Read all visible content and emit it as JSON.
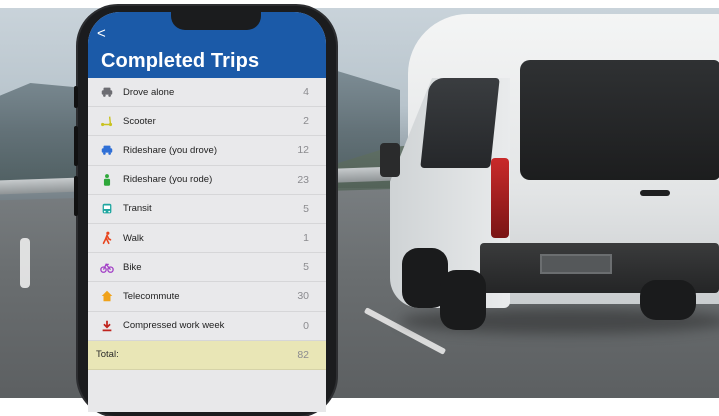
{
  "screen": {
    "back_label": "<",
    "title": "Completed Trips"
  },
  "trips": [
    {
      "label": "Drove alone",
      "value": "4",
      "icon": "car-icon",
      "color": "#6d6d72"
    },
    {
      "label": "Scooter",
      "value": "2",
      "icon": "scooter-icon",
      "color": "#c9c21f"
    },
    {
      "label": "Rideshare (you drove)",
      "value": "12",
      "icon": "car-icon",
      "color": "#2f6fd6"
    },
    {
      "label": "Rideshare (you rode)",
      "value": "23",
      "icon": "person-icon",
      "color": "#2fa83a"
    },
    {
      "label": "Transit",
      "value": "5",
      "icon": "bus-icon",
      "color": "#1fa6a0"
    },
    {
      "label": "Walk",
      "value": "1",
      "icon": "walk-icon",
      "color": "#e8451e"
    },
    {
      "label": "Bike",
      "value": "5",
      "icon": "bike-icon",
      "color": "#a23fc6"
    },
    {
      "label": "Telecommute",
      "value": "30",
      "icon": "home-icon",
      "color": "#f0a21a"
    },
    {
      "label": "Compressed work week",
      "value": "0",
      "icon": "download-icon",
      "color": "#c0231d"
    }
  ],
  "total": {
    "label": "Total:",
    "value": "82"
  },
  "colors": {
    "header": "#1b5aa8",
    "total_row": "#e9e6b6"
  }
}
